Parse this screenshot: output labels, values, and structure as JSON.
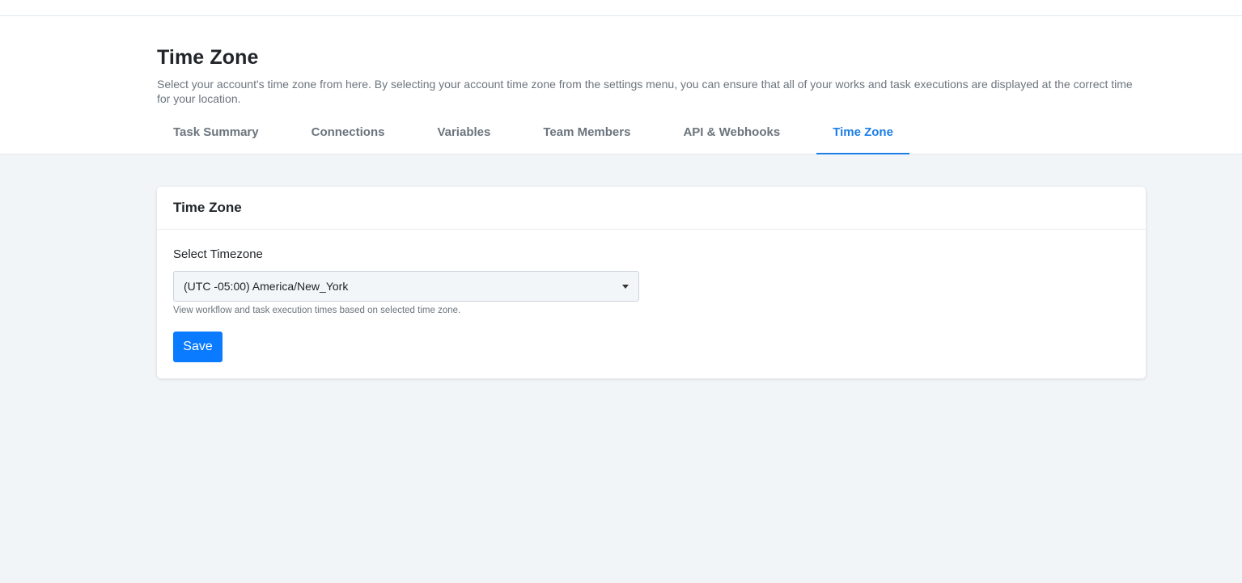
{
  "header": {
    "title": "Time Zone",
    "description": "Select your account's time zone from here. By selecting your account time zone from the settings menu, you can ensure that all of your works and task executions are displayed at the correct time for your location."
  },
  "tabs": [
    {
      "label": "Task Summary",
      "active": false
    },
    {
      "label": "Connections",
      "active": false
    },
    {
      "label": "Variables",
      "active": false
    },
    {
      "label": "Team Members",
      "active": false
    },
    {
      "label": "API & Webhooks",
      "active": false
    },
    {
      "label": "Time Zone",
      "active": true
    }
  ],
  "card": {
    "title": "Time Zone",
    "field_label": "Select Timezone",
    "selected_timezone": "(UTC -05:00) America/New_York",
    "help_text": "View workflow and task execution times based on selected time zone.",
    "save_label": "Save"
  },
  "colors": {
    "accent": "#1a7ee6",
    "button": "#0a7bff",
    "background": "#f2f5f8"
  },
  "icons": {
    "select_caret": "caret-down-icon"
  }
}
